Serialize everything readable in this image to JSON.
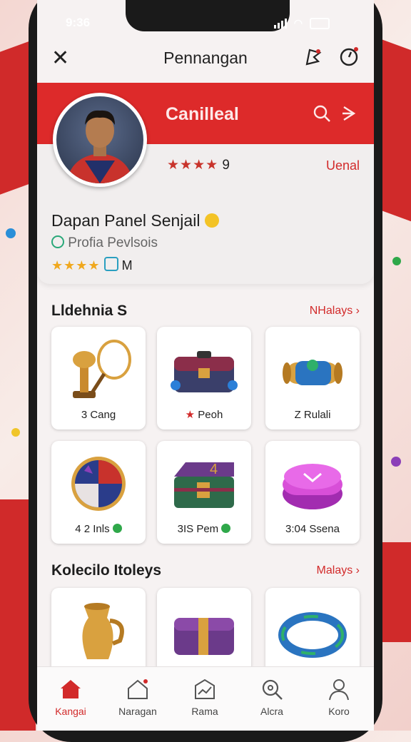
{
  "status": {
    "time": "9:36"
  },
  "header": {
    "title": "Pennangan"
  },
  "profile": {
    "banner_name": "Canilleal",
    "rating_value": "9",
    "right_link": "Uenal",
    "display_name": "Dapan Panel Senjail",
    "subtitle": "Profia Pevlsois",
    "badge_letter": "M"
  },
  "section1": {
    "title": "Lldehnia S",
    "see_all": "NHalays",
    "items": [
      {
        "label": "3 Cang",
        "icon": "trophy-racket-icon"
      },
      {
        "label": "Peoh",
        "icon": "chest-icon"
      },
      {
        "label": "Z Rulali",
        "icon": "scroll-icon"
      },
      {
        "label": "4 2 Inls",
        "icon": "orb-icon"
      },
      {
        "label": "3IS Pem",
        "icon": "crate-icon"
      },
      {
        "label": "3:04 Ssena",
        "icon": "gem-icon"
      }
    ]
  },
  "section2": {
    "title": "Kolecilo Itoleys",
    "see_all": "Malays",
    "items": [
      {
        "label": "",
        "icon": "jug-icon"
      },
      {
        "label": "",
        "icon": "box-icon"
      },
      {
        "label": "",
        "icon": "ring-icon"
      }
    ]
  },
  "nav": [
    {
      "label": "Kangai",
      "icon": "home-icon",
      "active": true
    },
    {
      "label": "Naragan",
      "icon": "house-icon",
      "active": false
    },
    {
      "label": "Rama",
      "icon": "chart-icon",
      "active": false
    },
    {
      "label": "Alcra",
      "icon": "search-icon",
      "active": false
    },
    {
      "label": "Koro",
      "icon": "profile-icon",
      "active": false
    }
  ],
  "colors": {
    "accent": "#dd2a2a",
    "background": "#f6f2f2"
  }
}
